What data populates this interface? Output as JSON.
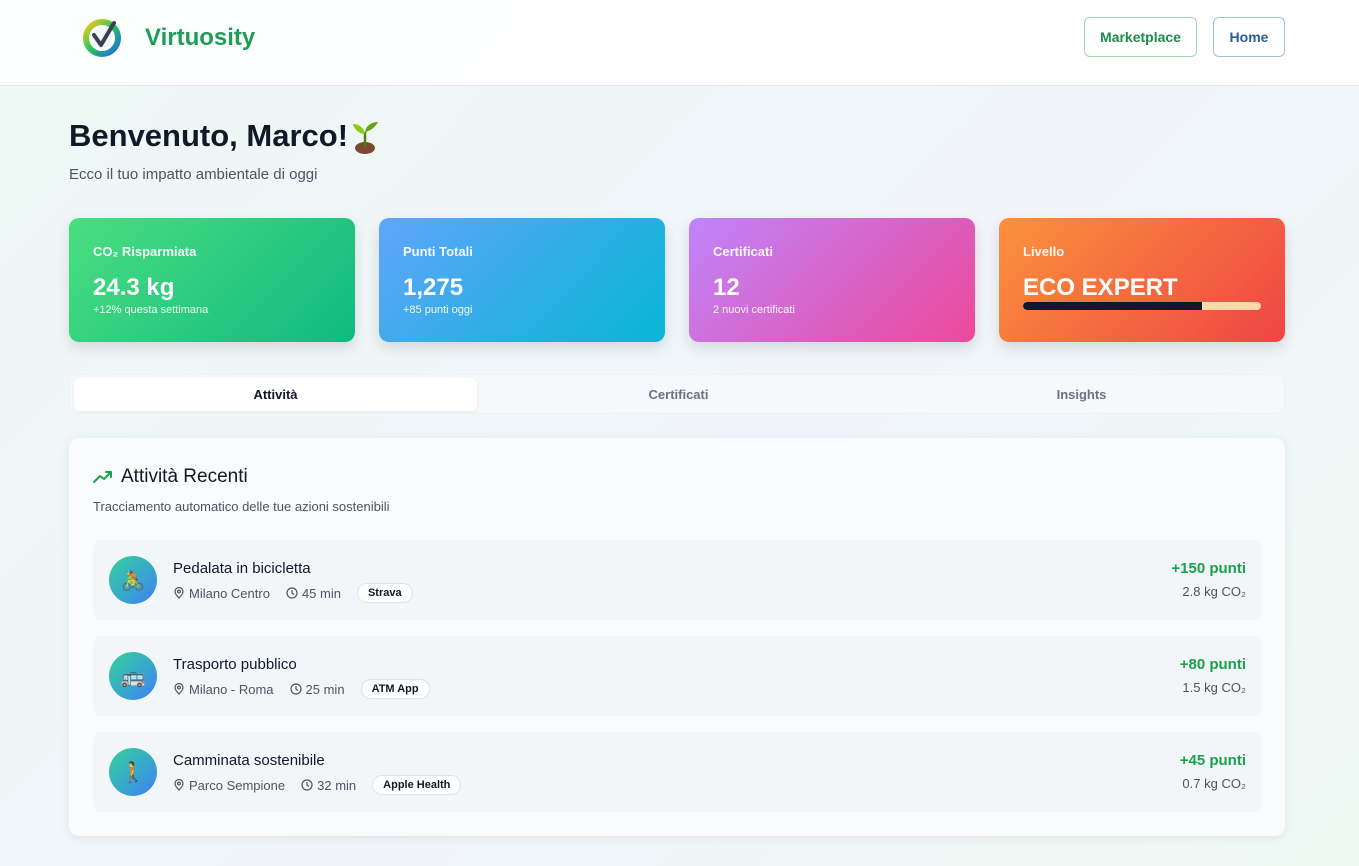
{
  "header": {
    "logo_text": "Virtuosity",
    "nav": {
      "marketplace": "Marketplace",
      "home": "Home"
    }
  },
  "welcome": {
    "title": "Benvenuto, Marco!",
    "subtitle": "Ecco il tuo impatto ambientale di oggi"
  },
  "stats": {
    "co2": {
      "label": "CO₂ Risparmiata",
      "value": "24.3 kg",
      "note": "+12% questa settimana"
    },
    "points": {
      "label": "Punti Totali",
      "value": "1,275",
      "note": "+85 punti oggi"
    },
    "certificates": {
      "label": "Certificati",
      "value": "12",
      "note": "2 nuovi certificati"
    },
    "level": {
      "label": "Livello",
      "value": "ECO EXPERT",
      "progress": 0.75
    }
  },
  "tabs": [
    {
      "label": "Attività",
      "active": true
    },
    {
      "label": "Certificati",
      "active": false
    },
    {
      "label": "Insights",
      "active": false
    }
  ],
  "activity": {
    "title": "Attività Recenti",
    "subtitle": "Tracciamento automatico delle tue azioni sostenibili",
    "items": [
      {
        "emoji": "🚴",
        "title": "Pedalata in bicicletta",
        "location": "Milano Centro",
        "duration": "45 min",
        "source": "Strava",
        "points": "+150 punti",
        "co2": "2.8 kg CO₂"
      },
      {
        "emoji": "🚌",
        "title": "Trasporto pubblico",
        "location": "Milano - Roma",
        "duration": "25 min",
        "source": "ATM App",
        "points": "+80 punti",
        "co2": "1.5 kg CO₂"
      },
      {
        "emoji": "🚶",
        "title": "Camminata sostenibile",
        "location": "Parco Sempione",
        "duration": "32 min",
        "source": "Apple Health",
        "points": "+45 punti",
        "co2": "0.7 kg CO₂"
      }
    ]
  },
  "colors": {
    "brand_green": "#1f9d57",
    "points_green": "#16a34a",
    "accent_blue": "#2a5d9c"
  }
}
